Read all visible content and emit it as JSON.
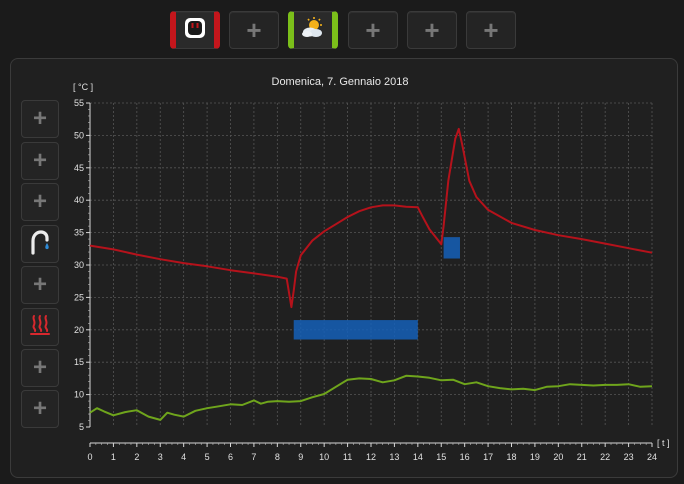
{
  "top_toolbar": {
    "buttons": [
      {
        "icon": "power-outlet-icon",
        "accent": "#c4161c",
        "active": true
      },
      {
        "icon": "plus-icon",
        "label": "+"
      },
      {
        "icon": "weather-cloud-sun-icon",
        "accent": "#7bbf1a",
        "active": true
      },
      {
        "icon": "plus-icon",
        "label": "+"
      },
      {
        "icon": "plus-icon",
        "label": "+"
      },
      {
        "icon": "plus-icon",
        "label": "+"
      }
    ]
  },
  "side_toolbar": {
    "buttons": [
      {
        "icon": "plus-icon",
        "label": "+"
      },
      {
        "icon": "plus-icon",
        "label": "+"
      },
      {
        "icon": "plus-icon",
        "label": "+"
      },
      {
        "icon": "faucet-icon"
      },
      {
        "icon": "plus-icon",
        "label": "+"
      },
      {
        "icon": "heating-icon",
        "accent": "#c4161c"
      },
      {
        "icon": "plus-icon",
        "label": "+"
      },
      {
        "icon": "plus-icon",
        "label": "+"
      }
    ]
  },
  "chart_data": {
    "type": "line",
    "title": "Domenica, 7. Gennaio 2018",
    "ylabel": "[ °C ]",
    "xlabel": "[ t ]",
    "xlim": [
      0,
      24
    ],
    "ylim": [
      5,
      55
    ],
    "xticks": [
      0,
      1,
      2,
      3,
      4,
      5,
      6,
      7,
      8,
      9,
      10,
      11,
      12,
      13,
      14,
      15,
      16,
      17,
      18,
      19,
      20,
      21,
      22,
      23,
      24
    ],
    "yticks": [
      5,
      10,
      15,
      20,
      25,
      30,
      35,
      40,
      45,
      50,
      55
    ],
    "grid": true,
    "colors": {
      "red_series": "#b5121b",
      "green_series": "#6fa51c",
      "blocks": "#1560b8"
    },
    "series": [
      {
        "color": "#b5121b",
        "x": [
          0,
          1,
          2,
          3,
          4,
          5,
          6,
          7,
          8,
          8.4,
          8.6,
          8.7,
          8.8,
          9.0,
          9.5,
          10,
          10.5,
          11,
          11.5,
          12,
          12.5,
          13,
          13.5,
          14,
          14.2,
          14.5,
          15,
          15.1,
          15.3,
          15.6,
          15.75,
          15.9,
          16.2,
          16.5,
          17,
          18,
          19,
          20,
          21,
          22,
          23,
          24
        ],
        "y": [
          33,
          32.4,
          31.6,
          30.9,
          30.3,
          29.8,
          29.2,
          28.7,
          28.2,
          27.9,
          23.5,
          26,
          29,
          31.5,
          33.8,
          35.2,
          36.3,
          37.4,
          38.3,
          38.9,
          39.2,
          39.2,
          39.0,
          38.9,
          37.5,
          35.5,
          33.2,
          36,
          43,
          49.5,
          51,
          48.5,
          43,
          40.5,
          38.5,
          36.5,
          35.4,
          34.6,
          34.0,
          33.3,
          32.6,
          31.9
        ]
      },
      {
        "color": "#6fa51c",
        "x": [
          0,
          0.3,
          0.6,
          1,
          1.5,
          2,
          2.5,
          3,
          3.3,
          3.6,
          4,
          4.5,
          5,
          5.5,
          6,
          6.5,
          7,
          7.3,
          7.6,
          8,
          8.5,
          9,
          9.5,
          10,
          10.5,
          11,
          11.5,
          12,
          12.5,
          13,
          13.5,
          14,
          14.5,
          15,
          15.5,
          16,
          16.5,
          17,
          17.5,
          18,
          18.5,
          19,
          19.5,
          20,
          20.5,
          21,
          21.5,
          22,
          22.5,
          23,
          23.5,
          24
        ],
        "y": [
          7.2,
          7.9,
          7.4,
          6.8,
          7.3,
          7.6,
          6.6,
          6.1,
          7.2,
          6.9,
          6.6,
          7.5,
          7.9,
          8.2,
          8.5,
          8.4,
          9.1,
          8.6,
          8.9,
          9.0,
          8.9,
          9.0,
          9.6,
          10.1,
          11.2,
          12.3,
          12.5,
          12.4,
          11.9,
          12.2,
          12.9,
          12.8,
          12.6,
          12.2,
          12.3,
          11.6,
          11.9,
          11.3,
          11.0,
          10.8,
          10.9,
          10.7,
          11.2,
          11.3,
          11.6,
          11.5,
          11.4,
          11.5,
          11.5,
          11.6,
          11.2,
          11.3
        ]
      }
    ],
    "blocks": [
      {
        "x_start": 8.7,
        "x_end": 14.0,
        "y_low": 18.5,
        "y_high": 21.5
      },
      {
        "x_start": 15.1,
        "x_end": 15.8,
        "y_low": 31.0,
        "y_high": 34.3
      }
    ]
  }
}
